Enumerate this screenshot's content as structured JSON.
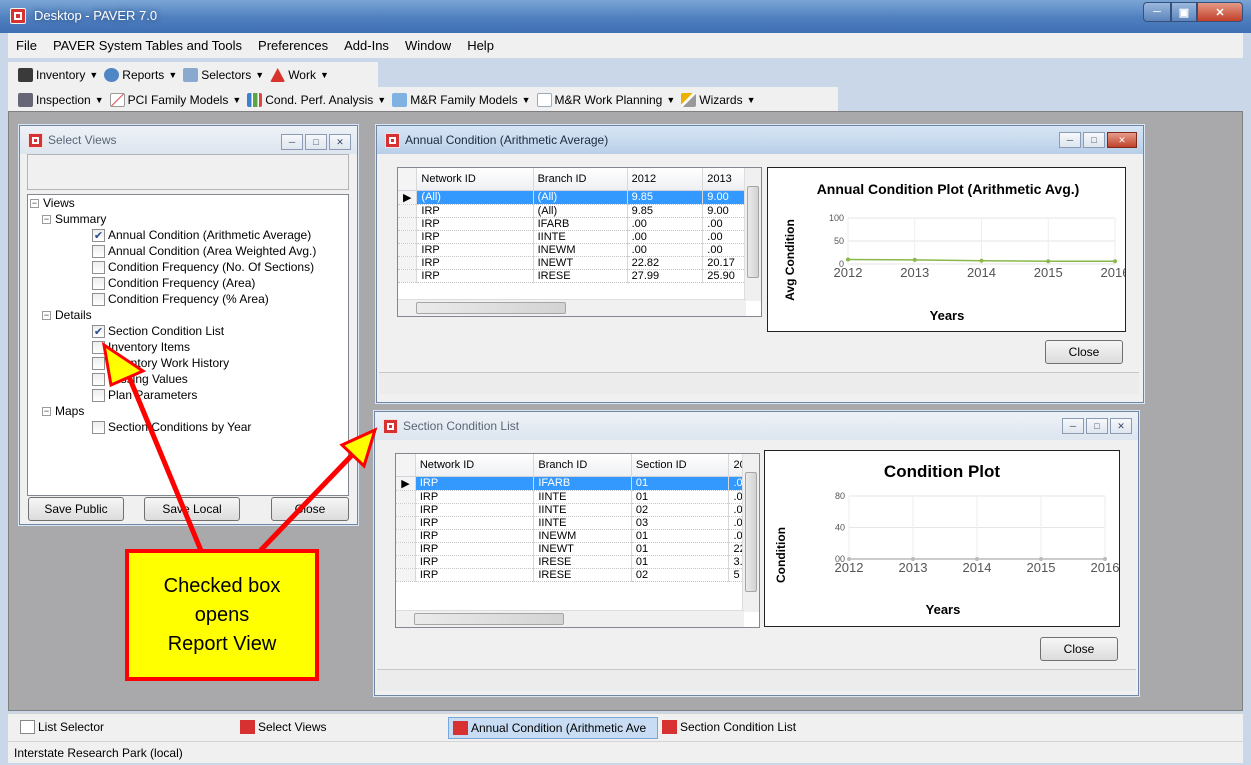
{
  "app": {
    "title": "Desktop - PAVER 7.0"
  },
  "menu": [
    "File",
    "PAVER System Tables and Tools",
    "Preferences",
    "Add-Ins",
    "Window",
    "Help"
  ],
  "toolbar1": [
    {
      "label": "Inventory",
      "icon": "inventory-icon",
      "color": "#3a3a3a"
    },
    {
      "label": "Reports",
      "icon": "reports-icon",
      "color": "#4f86c6"
    },
    {
      "label": "Selectors",
      "icon": "selectors-icon",
      "color": "#8aa9cf"
    },
    {
      "label": "Work",
      "icon": "work-icon",
      "color": "#d8342c"
    }
  ],
  "toolbar2": [
    {
      "label": "Inspection",
      "icon": "inspection-icon",
      "color": "#556"
    },
    {
      "label": "PCI Family Models",
      "icon": "pci-model-icon",
      "color": "#999"
    },
    {
      "label": "Cond. Perf. Analysis",
      "icon": "bar-chart-icon",
      "color": "#3d7fd0"
    },
    {
      "label": "M&R Family Models",
      "icon": "mr-model-icon",
      "color": "#7fb2e0"
    },
    {
      "label": "M&R Work Planning",
      "icon": "planning-icon",
      "color": "#b6c8dc"
    },
    {
      "label": "Wizards",
      "icon": "wand-icon",
      "color": "#f0b000"
    }
  ],
  "select_views": {
    "title": "Select Views",
    "tree": {
      "root": "Views",
      "summary": "Summary",
      "summary_items": [
        {
          "label": "Annual Condition (Arithmetic Average)",
          "checked": true
        },
        {
          "label": "Annual Condition (Area Weighted Avg.)",
          "checked": false
        },
        {
          "label": "Condition Frequency (No. Of Sections)",
          "checked": false
        },
        {
          "label": "Condition Frequency (Area)",
          "checked": false
        },
        {
          "label": "Condition Frequency (% Area)",
          "checked": false
        }
      ],
      "details": "Details",
      "details_items": [
        {
          "label": "Section Condition List",
          "checked": true
        },
        {
          "label": "Inventory Items",
          "checked": false
        },
        {
          "label": "Inventory Work History",
          "checked": false
        },
        {
          "label": "Missing Values",
          "checked": false
        },
        {
          "label": "Plan Parameters",
          "checked": false
        }
      ],
      "maps": "Maps",
      "maps_items": [
        {
          "label": "Section Conditions by Year",
          "checked": false
        }
      ]
    },
    "buttons": {
      "save_public": "Save Public",
      "save_local": "Save Local",
      "close": "Close"
    }
  },
  "annual": {
    "title": "Annual Condition (Arithmetic Average)",
    "columns": [
      "Network ID",
      "Branch ID",
      "2012",
      "2013"
    ],
    "rows": [
      [
        "(All)",
        "(All)",
        "9.85",
        "9.00"
      ],
      [
        "IRP",
        "(All)",
        "9.85",
        "9.00"
      ],
      [
        "IRP",
        "IFARB",
        ".00",
        ".00"
      ],
      [
        "IRP",
        "IINTE",
        ".00",
        ".00"
      ],
      [
        "IRP",
        "INEWM",
        ".00",
        ".00"
      ],
      [
        "IRP",
        "INEWT",
        "22.82",
        "20.17"
      ],
      [
        "IRP",
        "IRESE",
        "27.99",
        "25.90"
      ]
    ],
    "close": "Close",
    "chart_data": {
      "type": "line",
      "title": "Annual Condition Plot (Arithmetic Avg.)",
      "xlabel": "Years",
      "ylabel": "Avg Condition",
      "x": [
        2012,
        2013,
        2014,
        2015,
        2016
      ],
      "ylim": [
        0,
        100
      ],
      "yticks": [
        0,
        50,
        100
      ],
      "series": [
        {
          "values": [
            9.85,
            9,
            7,
            6,
            6
          ],
          "color": "#8ab84a"
        }
      ]
    }
  },
  "section": {
    "title": "Section Condition List",
    "columns": [
      "Network ID",
      "Branch ID",
      "Section ID",
      "20"
    ],
    "rows": [
      [
        "IRP",
        "IFARB",
        "01",
        ".0"
      ],
      [
        "IRP",
        "IINTE",
        "01",
        ".0"
      ],
      [
        "IRP",
        "IINTE",
        "02",
        ".0"
      ],
      [
        "IRP",
        "IINTE",
        "03",
        ".0"
      ],
      [
        "IRP",
        "INEWM",
        "01",
        ".0"
      ],
      [
        "IRP",
        "INEWT",
        "01",
        "22"
      ],
      [
        "IRP",
        "IRESE",
        "01",
        "3."
      ],
      [
        "IRP",
        "IRESE",
        "02",
        "5"
      ]
    ],
    "close": "Close",
    "chart_data": {
      "type": "line",
      "title": "Condition Plot",
      "xlabel": "Years",
      "ylabel": "Condition",
      "x": [
        2012,
        2013,
        2014,
        2015,
        2016
      ],
      "ylim": [
        0,
        80
      ],
      "yticks": [
        "00",
        "40",
        "80"
      ],
      "series": [
        {
          "values": [
            0,
            0,
            0,
            0,
            0
          ],
          "color": "#bbbbbb"
        }
      ]
    }
  },
  "taskbar": [
    {
      "label": "List Selector",
      "icon": "list-icon"
    },
    {
      "label": "Select Views",
      "icon": "paver-icon"
    },
    {
      "label": "Annual Condition (Arithmetic Ave",
      "icon": "paver-icon"
    },
    {
      "label": "Section Condition List",
      "icon": "paver-icon"
    }
  ],
  "status": "Interstate Research Park (local)",
  "callout": {
    "line1": "Checked box",
    "line2": "opens",
    "line3": "Report View"
  }
}
